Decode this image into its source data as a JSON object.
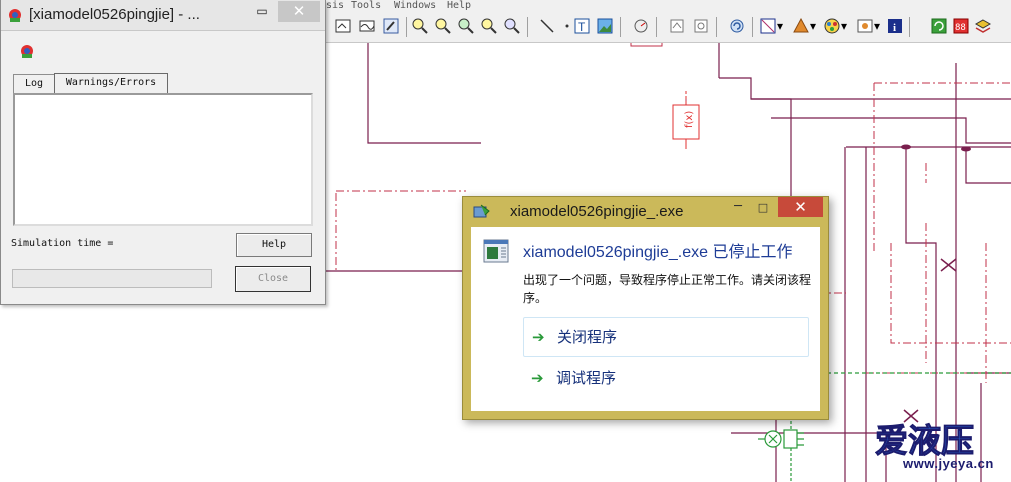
{
  "menubar": {
    "items": [
      "sis",
      "Tools",
      "Windows",
      "Help"
    ]
  },
  "toolbar": {
    "buttons": [
      "zoom-in",
      "zoom-out",
      "zoom-fit",
      "zoom-window",
      "zoom-previous",
      "line",
      "text",
      "image",
      "settings",
      "supercomponent",
      "parameter",
      "run",
      "options"
    ]
  },
  "log_window": {
    "title": "[xiamodel0526pingjie] - ...",
    "minimize_label": "▭",
    "close_label": "✕",
    "tabs": [
      "Log",
      "Warnings/Errors"
    ],
    "active_tab": "Warnings/Errors",
    "log_text": "",
    "simulation_time_label": "Simulation time =",
    "simulation_time_value": "",
    "help_button": "Help",
    "close_button": "Close",
    "progress": 0
  },
  "error_dialog": {
    "title": "xiamodel0526pingjie_.exe",
    "heading": "xiamodel0526pingjie_.exe 已停止工作",
    "message": "出现了一个问题，导致程序停止正常工作。请关闭该程序。",
    "commands": [
      "关闭程序",
      "调试程序"
    ],
    "minimize_label": "─",
    "maximize_label": "□",
    "close_label": "✕",
    "command_arrow": "➔"
  },
  "watermark": {
    "logo_text": "爱液压",
    "url": "www.jyeya.cn"
  },
  "colors": {
    "dialog_frame": "#cbb95a",
    "dialog_close": "#c74a3a",
    "circuit_line": "#7a1f4e",
    "circuit_dash": "#c0304a",
    "signal_green": "#2a9a3a",
    "function_red": "#e03030"
  }
}
